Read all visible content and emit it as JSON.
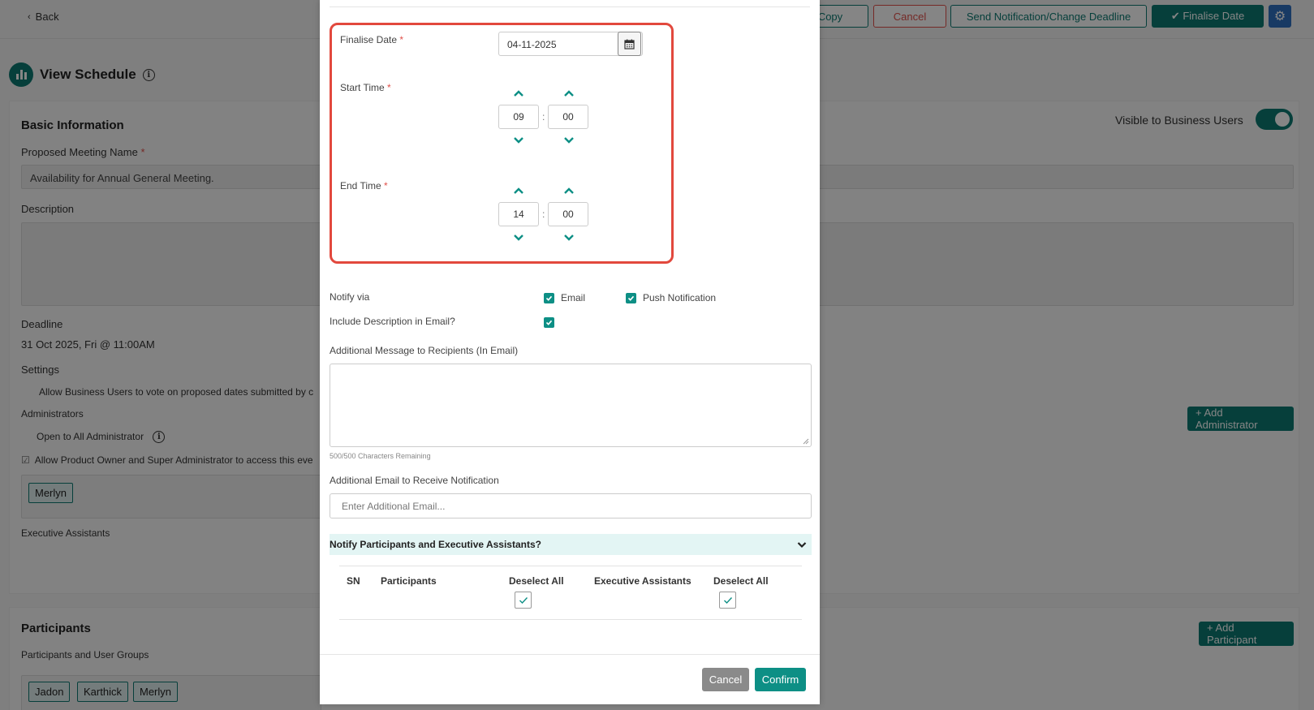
{
  "topbar": {
    "back_label": "Back",
    "copy_label": "Copy",
    "cancel_label": "Cancel",
    "notify_label": "Send Notification/Change Deadline",
    "finalise_label": "✔ Finalise Date"
  },
  "page": {
    "title": "View Schedule"
  },
  "basic_info": {
    "section_title": "Basic Information",
    "visible_label": "Visible to Business Users",
    "meeting_name_label": "Proposed Meeting Name",
    "meeting_name_value": "Availability for Annual General Meeting.",
    "description_label": "Description",
    "deadline_label": "Deadline",
    "deadline_value": "31 Oct 2025, Fri @ 11:00AM",
    "settings_label": "Settings",
    "settings_allow_vote": "Allow Business Users to vote on proposed dates submitted by c",
    "administrators_label": "Administrators",
    "open_to_all_label": "Open to All Administrator",
    "allow_product_owner": "Allow Product Owner and Super Administrator to access this eve",
    "admin_tags": [
      "Merlyn"
    ],
    "add_admin_label": "+ Add Administrator",
    "exec_assistants_label": "Executive Assistants"
  },
  "participants_section": {
    "title": "Participants",
    "sub_label": "Participants and User Groups",
    "add_label": "+ Add Participant",
    "tags": [
      "Jadon",
      "Karthick",
      "Merlyn"
    ]
  },
  "modal": {
    "finalise_date_label": "Finalise Date",
    "finalise_date_value": "04-11-2025",
    "start_time_label": "Start Time",
    "start_hour": "09",
    "start_minute": "00",
    "end_time_label": "End Time",
    "end_hour": "14",
    "end_minute": "00",
    "required_mark": "*",
    "time_separator": ":",
    "notify_via_label": "Notify via",
    "email_label": "Email",
    "push_label": "Push Notification",
    "include_desc_label": "Include Description in Email?",
    "additional_msg_label": "Additional Message to Recipients (In Email)",
    "char_remaining": "500/500 Characters Remaining",
    "additional_email_label": "Additional Email to Receive Notification",
    "additional_email_placeholder": "Enter Additional Email...",
    "accordion_title": "Notify Participants and Executive Assistants?",
    "table_headers": {
      "sn": "SN",
      "participants": "Participants",
      "deselect_all_1": "Deselect All",
      "exec_assistants": "Executive Assistants",
      "deselect_all_2": "Deselect All"
    },
    "cancel_label": "Cancel",
    "confirm_label": "Confirm"
  },
  "colors": {
    "primary": "#0d7a72",
    "accent_check": "#0d8f85",
    "danger": "#e0504a",
    "highlight_box": "#e2483d",
    "gear_blue": "#2e6fc0"
  },
  "icons": [
    "chevron-left-icon",
    "bar-chart-icon",
    "info-icon",
    "gear-icon",
    "calendar-icon",
    "chevron-up-icon",
    "chevron-down-icon",
    "checkmark-icon"
  ]
}
